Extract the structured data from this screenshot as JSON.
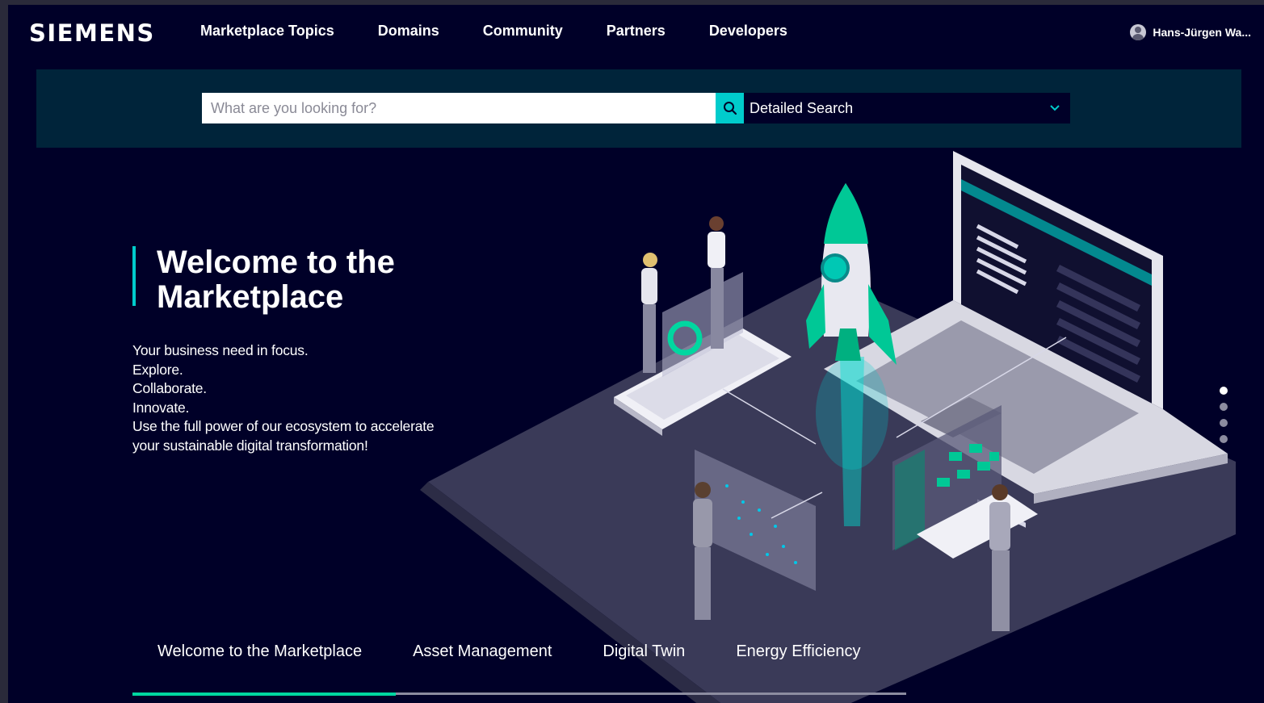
{
  "header": {
    "logo": "SIEMENS",
    "nav": [
      "Marketplace Topics",
      "Domains",
      "Community",
      "Partners",
      "Developers"
    ],
    "user_name": "Hans-Jürgen Wa..."
  },
  "search": {
    "placeholder": "What are you looking for?",
    "detailed_label": "Detailed Search"
  },
  "hero": {
    "title": "Welcome to the Marketplace",
    "lines": [
      "Your business need in focus.",
      "Explore.",
      "Collaborate.",
      "Innovate.",
      "Use the full power of our ecosystem to accelerate",
      "your sustainable digital transformation!"
    ]
  },
  "carousel": {
    "slide_count": 4,
    "active_slide": 1
  },
  "tabs": {
    "items": [
      "Welcome to the Marketplace",
      "Asset Management",
      "Digital Twin",
      "Energy Efficiency"
    ],
    "active": 0
  },
  "colors": {
    "background": "#000028",
    "search_band": "#00243a",
    "accent_teal": "#00cccc",
    "accent_green": "#00d7a0"
  }
}
